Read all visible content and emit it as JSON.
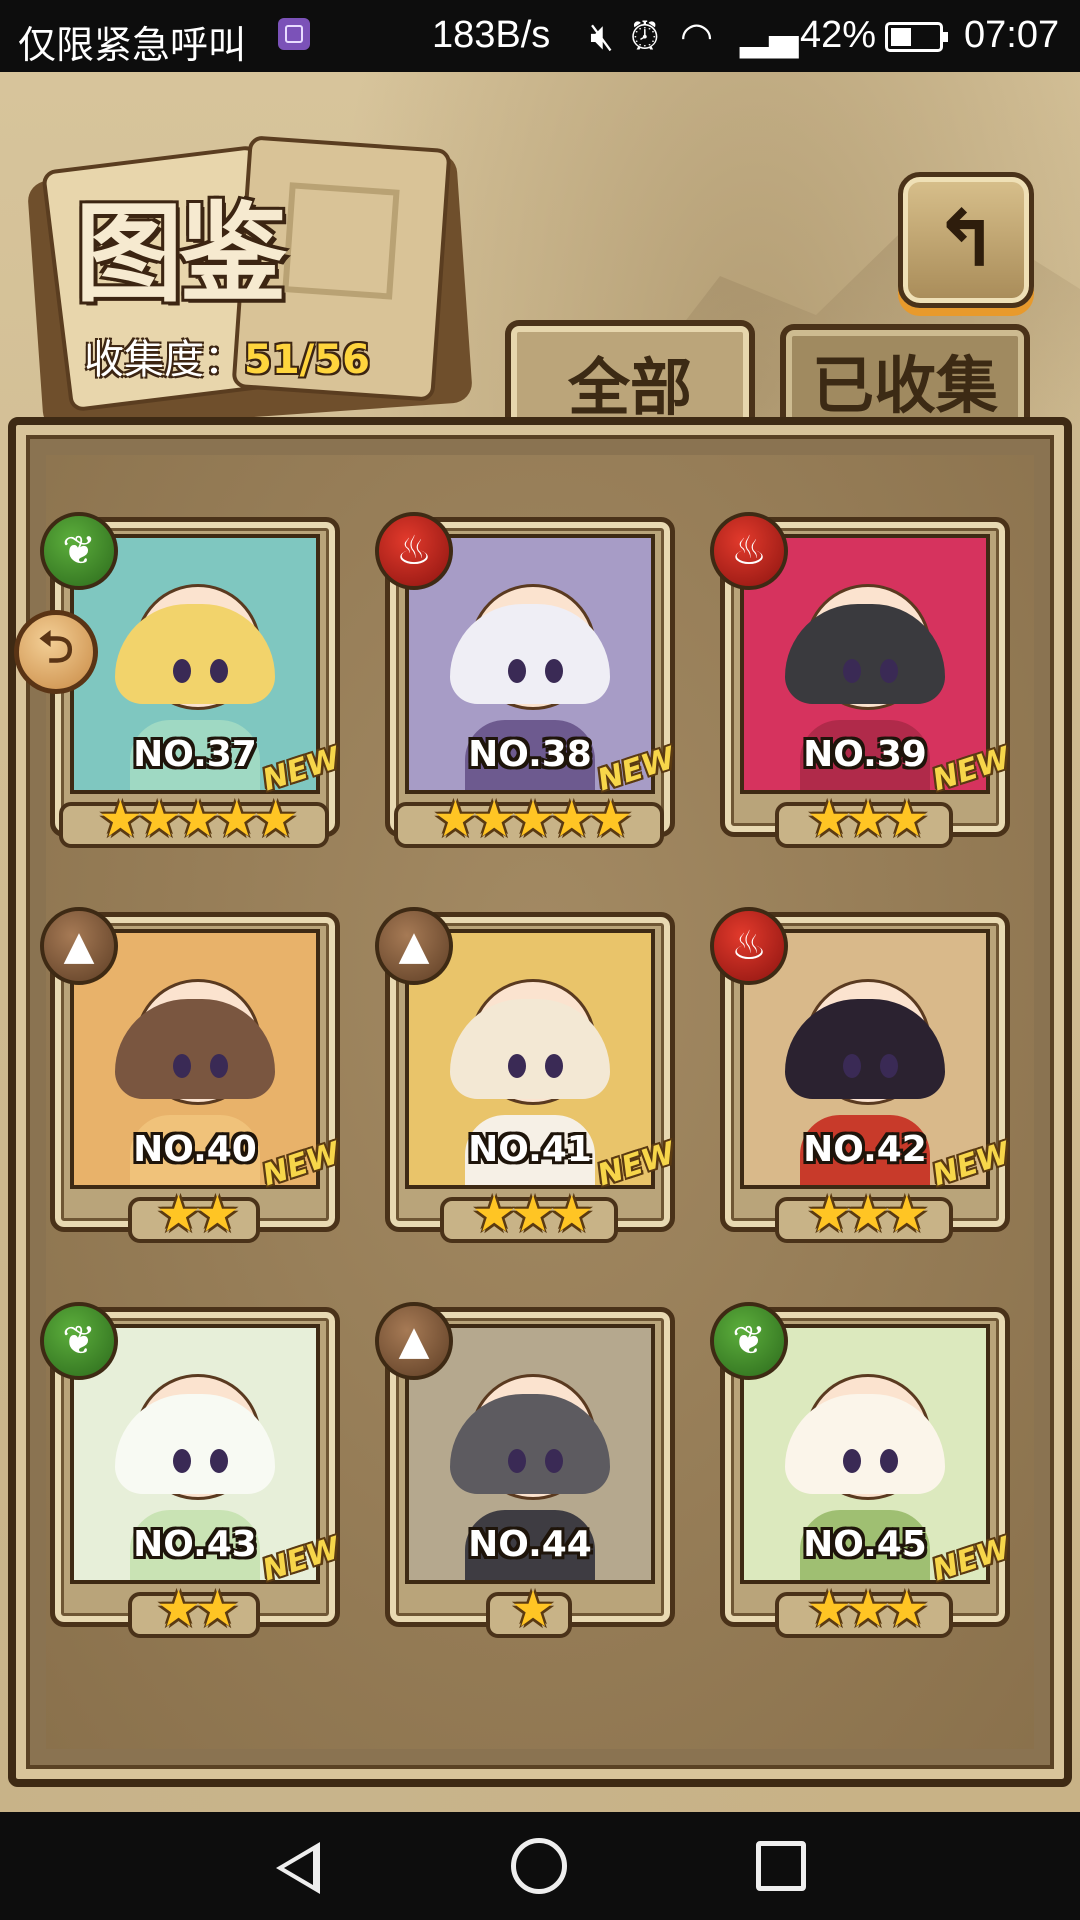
{
  "status_bar": {
    "carrier": "仅限紧急呼叫",
    "speed": "183B/s",
    "battery_pct": "42%",
    "time": "07:07",
    "icons": [
      "notification-app-icon",
      "mute-icon",
      "alarm-icon",
      "wifi-icon",
      "signal-icon",
      "battery-icon"
    ]
  },
  "header": {
    "title": "图鉴",
    "collect_label": "收集度：",
    "collect_value": "51/56",
    "back_icon": "return-arrow-icon"
  },
  "tabs": [
    {
      "label": "全部",
      "active": true
    },
    {
      "label": "已收集",
      "active": false
    }
  ],
  "cards": [
    {
      "no": "NO.37",
      "element": "nature",
      "stars": "★★★★★",
      "new": "NEW",
      "palette": {
        "bg": "#7fc7c0",
        "hair": "#f2d36b",
        "body": "#9fd9c3"
      }
    },
    {
      "no": "NO.38",
      "element": "fire",
      "stars": "★★★★★",
      "new": "NEW",
      "palette": {
        "bg": "#a79cc6",
        "hair": "#efeef5",
        "body": "#6d5a8f"
      }
    },
    {
      "no": "NO.39",
      "element": "fire",
      "stars": "★★★",
      "new": "NEW",
      "palette": {
        "bg": "#d6335e",
        "hair": "#3a3a3e",
        "body": "#b02a4a"
      }
    },
    {
      "no": "NO.40",
      "element": "earth",
      "stars": "★★",
      "new": "NEW",
      "palette": {
        "bg": "#e8b26a",
        "hair": "#7a5640",
        "body": "#f0c27a"
      }
    },
    {
      "no": "NO.41",
      "element": "earth",
      "stars": "★★★",
      "new": "NEW",
      "palette": {
        "bg": "#e9c46a",
        "hair": "#f3e8d4",
        "body": "#f6f0e6"
      }
    },
    {
      "no": "NO.42",
      "element": "fire",
      "stars": "★★★",
      "new": "NEW",
      "palette": {
        "bg": "#d9b98a",
        "hair": "#2b2230",
        "body": "#c83a2a"
      }
    },
    {
      "no": "NO.43",
      "element": "nature",
      "stars": "★★",
      "new": "NEW",
      "palette": {
        "bg": "#e7efd9",
        "hair": "#f8faf3",
        "body": "#c9e3b4"
      }
    },
    {
      "no": "NO.44",
      "element": "earth",
      "stars": "★",
      "new": "",
      "palette": {
        "bg": "#b5a88e",
        "hair": "#5d5b60",
        "body": "#3e3c42"
      }
    },
    {
      "no": "NO.45",
      "element": "nature",
      "stars": "★★★",
      "new": "NEW",
      "palette": {
        "bg": "#dce9be",
        "hair": "#fbf5ea",
        "body": "#9fbf72"
      }
    }
  ],
  "element_icons": {
    "nature": "leaf-icon",
    "fire": "flame-icon",
    "earth": "mountain-icon"
  },
  "nav_bar": {
    "icons": [
      "back-nav-icon",
      "home-nav-icon",
      "recent-apps-nav-icon"
    ]
  }
}
